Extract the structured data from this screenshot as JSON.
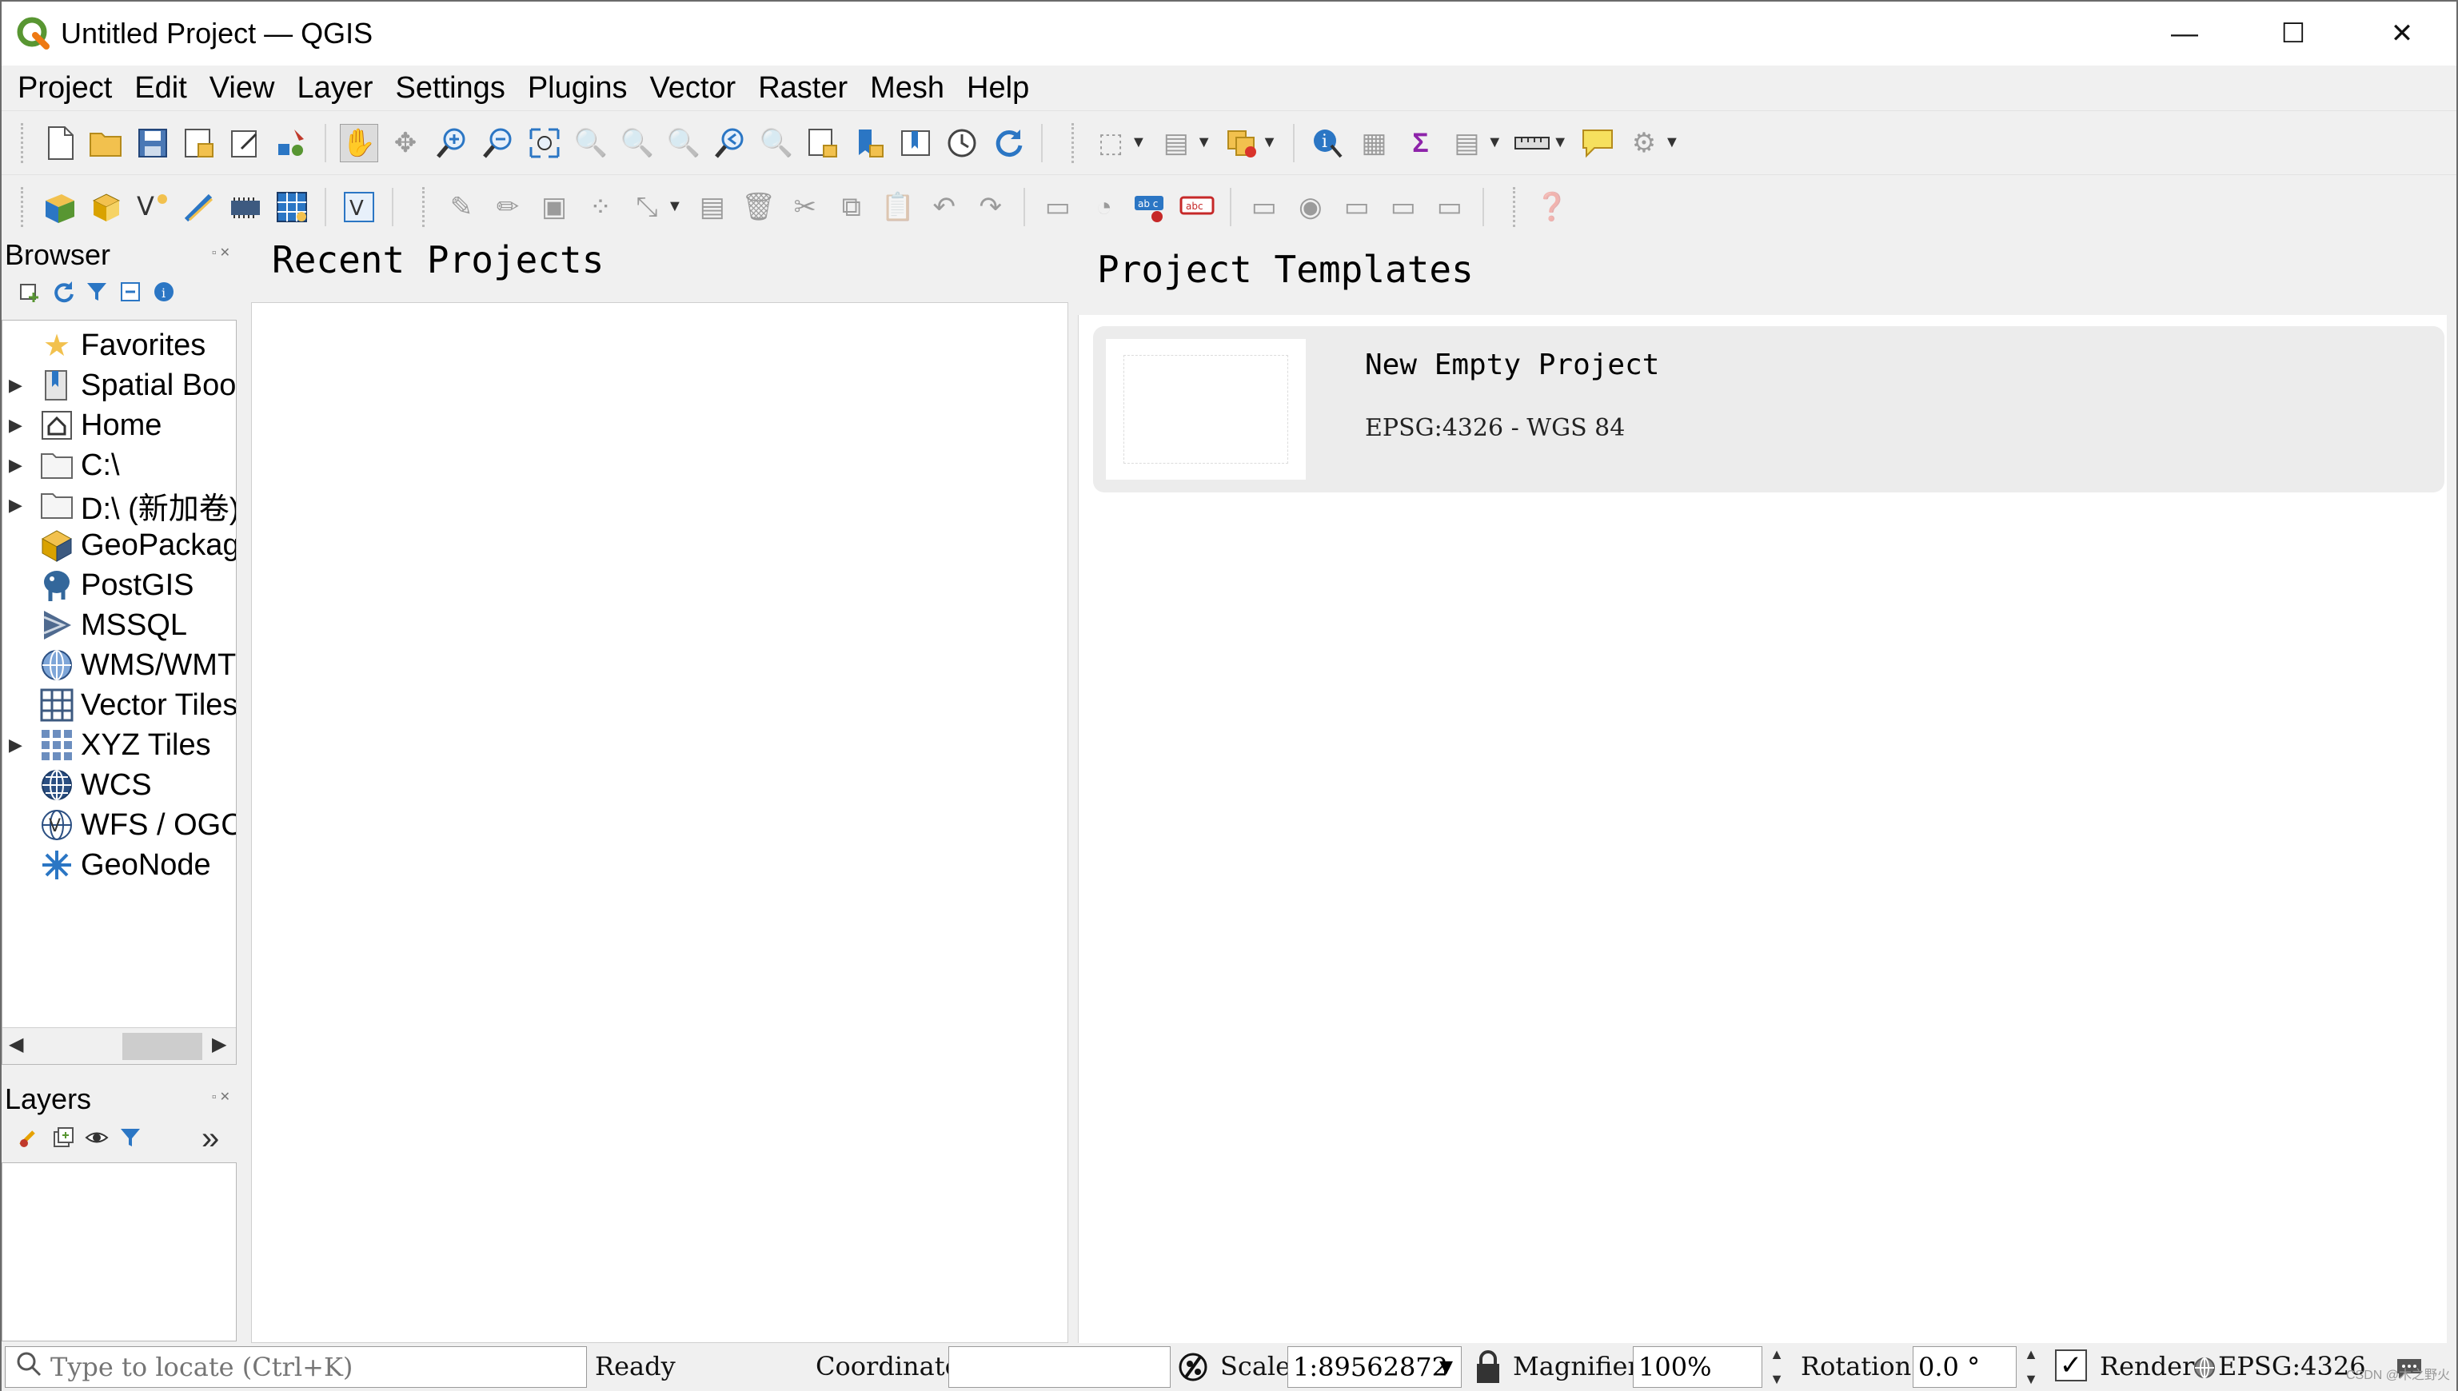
{
  "window": {
    "title": "Untitled Project — QGIS",
    "minimize": "—",
    "maximize": "☐",
    "close": "✕"
  },
  "menu": [
    "Project",
    "Edit",
    "View",
    "Layer",
    "Settings",
    "Plugins",
    "Vector",
    "Raster",
    "Mesh",
    "Help"
  ],
  "browser": {
    "title": "Browser",
    "items": [
      {
        "label": "Favorites",
        "icon": "star-icon",
        "expandable": false
      },
      {
        "label": "Spatial Boo",
        "icon": "bookmark-icon",
        "expandable": true
      },
      {
        "label": "Home",
        "icon": "home-icon",
        "expandable": true
      },
      {
        "label": "C:\\",
        "icon": "folder-icon",
        "expandable": true
      },
      {
        "label": "D:\\ (新加卷)",
        "icon": "folder-icon",
        "expandable": true
      },
      {
        "label": "GeoPackag",
        "icon": "geopackage-icon",
        "expandable": false
      },
      {
        "label": "PostGIS",
        "icon": "postgis-icon",
        "expandable": false
      },
      {
        "label": "MSSQL",
        "icon": "mssql-icon",
        "expandable": false
      },
      {
        "label": "WMS/WMT",
        "icon": "wms-icon",
        "expandable": false
      },
      {
        "label": "Vector Tiles",
        "icon": "vector-tiles-icon",
        "expandable": false
      },
      {
        "label": "XYZ Tiles",
        "icon": "xyz-tiles-icon",
        "expandable": true
      },
      {
        "label": "WCS",
        "icon": "wcs-icon",
        "expandable": false
      },
      {
        "label": "WFS / OGC",
        "icon": "wfs-icon",
        "expandable": false
      },
      {
        "label": "GeoNode",
        "icon": "geonode-icon",
        "expandable": false
      }
    ]
  },
  "layers": {
    "title": "Layers",
    "more": "»"
  },
  "recent": {
    "title": "Recent Projects"
  },
  "templates": {
    "title": "Project Templates",
    "items": [
      {
        "name": "New Empty Project",
        "crs": "EPSG:4326 - WGS 84"
      }
    ]
  },
  "status": {
    "locator_placeholder": "Type to locate (Ctrl+K)",
    "ready": "Ready",
    "coordinate_label": "Coordinate",
    "coordinate_value": "",
    "scale_label": "Scale",
    "scale_value": "1:89562872",
    "magnifier_label": "Magnifier",
    "magnifier_value": "100%",
    "rotation_label": "Rotation",
    "rotation_value": "0.0 °",
    "render_label": "Render",
    "crs": "EPSG:4326",
    "watermark": "CSDN @木之野火"
  },
  "colors": {
    "qgis_green": "#589632",
    "qgis_yellow": "#ee7913",
    "accent_blue": "#2b76c4"
  }
}
